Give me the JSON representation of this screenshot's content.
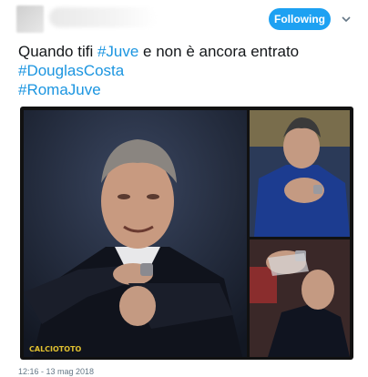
{
  "header": {
    "follow_label": "Following"
  },
  "tweet": {
    "text_plain": "Quando tifi ",
    "tag_juve": "#Juve",
    "text_after": " e non è ancora entrato",
    "tag_douglas": "#DouglasCosta",
    "tag_roma": "#RomaJuve"
  },
  "media": {
    "credit": "CALCIOTOTO"
  },
  "footer": {
    "timestamp": "12:16 - 13 mag 2018"
  }
}
